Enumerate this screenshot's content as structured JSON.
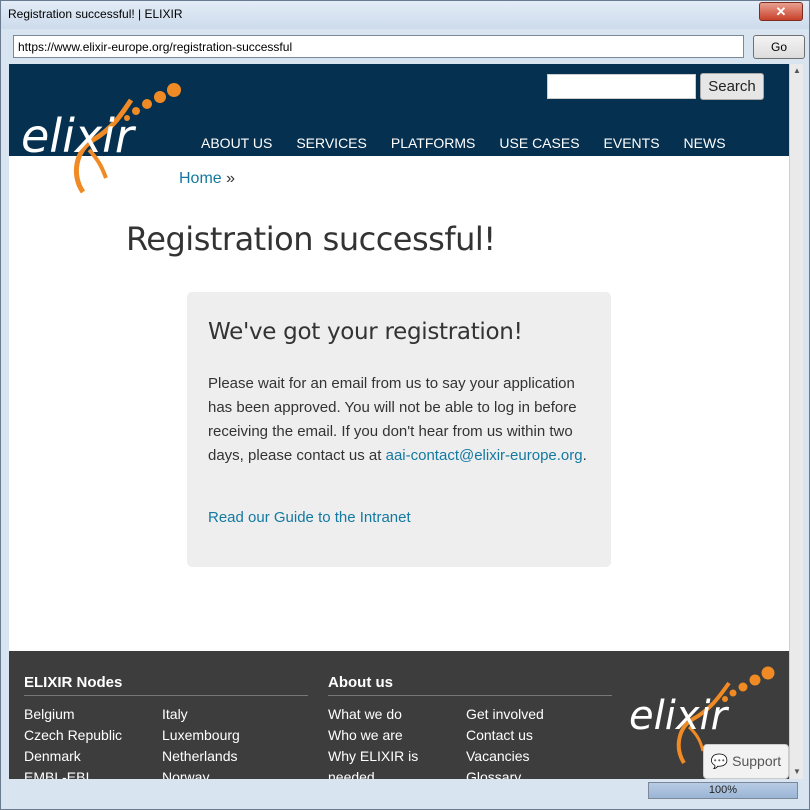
{
  "window": {
    "title": "Registration successful! | ELIXIR",
    "close_label": "✕"
  },
  "addressbar": {
    "url": "https://www.elixir-europe.org/registration-successful",
    "go_label": "Go"
  },
  "header": {
    "logo_text": "elixir",
    "search_button": "Search",
    "search_placeholder": "",
    "nav": [
      "ABOUT US",
      "SERVICES",
      "PLATFORMS",
      "USE CASES",
      "EVENTS",
      "NEWS"
    ]
  },
  "breadcrumb": {
    "home": "Home",
    "separator": " »"
  },
  "page_title": "Registration successful!",
  "callout": {
    "heading": "We've got your registration!",
    "message_before": "Please wait for an email from us to say your application has been approved. You will not be able to log in before receiving the email. If you don't hear from us within two days, please contact us at ",
    "email": "aai-contact@elixir-europe.org",
    "message_after": ".",
    "guide_link": "Read our Guide to the Intranet"
  },
  "footer": {
    "nodes": {
      "heading": "ELIXIR Nodes",
      "col1": [
        "Belgium",
        "Czech Republic",
        "Denmark",
        "EMBL-EBI"
      ],
      "col2": [
        "Italy",
        "Luxembourg",
        "Netherlands",
        "Norway"
      ]
    },
    "about": {
      "heading": "About us",
      "col1": [
        "What we do",
        "Who we are",
        "Why ELIXIR is",
        "needed"
      ],
      "col2": [
        "Get involved",
        "Contact us",
        "Vacancies",
        "Glossary"
      ]
    }
  },
  "support_label": "💬 Support",
  "status": {
    "zoom": "100%"
  },
  "colors": {
    "header_bg": "#06304f",
    "accent_orange": "#f08a24",
    "link": "#1479a1",
    "footer_bg": "#3d3d3d"
  }
}
